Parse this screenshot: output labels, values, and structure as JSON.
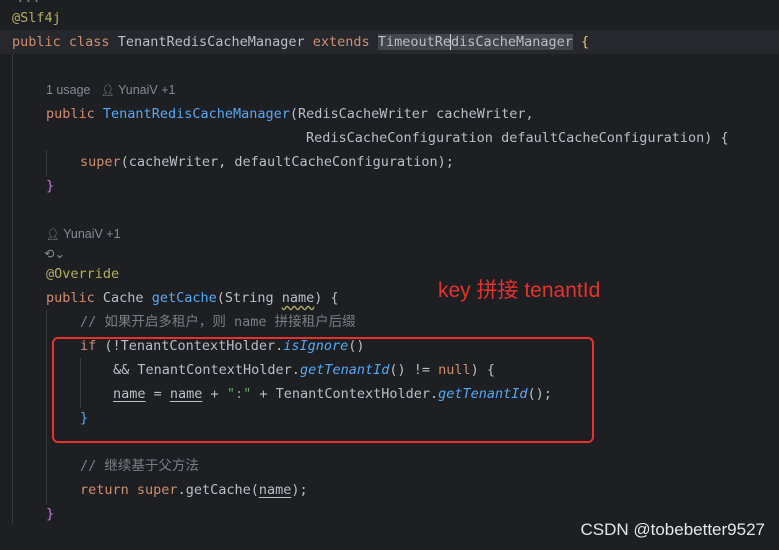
{
  "code": {
    "annotation_slf4j": "@Slf4j",
    "class_decl": {
      "kw_public": "public",
      "kw_class": "class",
      "name": "TenantRedisCacheManager",
      "kw_extends": "extends",
      "parent_a": "TimeoutRe",
      "parent_b": "disCacheManager",
      "brace": "{"
    },
    "ctor_meta": {
      "usage": "1 usage",
      "author": "YunaiV +1"
    },
    "ctor_sig": {
      "kw_public": "public",
      "name": "TenantRedisCacheManager",
      "params1": "(RedisCacheWriter cacheWriter,",
      "params2": "RedisCacheConfiguration defaultCacheConfiguration) {"
    },
    "ctor_body": {
      "kw_super": "super",
      "args": "(cacheWriter, defaultCacheConfiguration);"
    },
    "close_brace": "}",
    "method_meta": {
      "author": "YunaiV +1",
      "icon_label": "⟲⌄"
    },
    "override": "@Override",
    "method_sig": {
      "kw_public": "public",
      "ret": "Cache",
      "name": "getCache",
      "params_open": "(String ",
      "param_name": "name",
      "params_close": ") {"
    },
    "comment1": "// 如果开启多租户，则 name 拼接租户后缀",
    "if_line": {
      "kw_if": "if",
      "open": " (!TenantContextHolder.",
      "call": "isIgnore",
      "paren": "()"
    },
    "and_line": {
      "op": "&& TenantContextHolder.",
      "call": "getTenantId",
      "mid": "() != ",
      "kw_null": "null",
      "close": ") {"
    },
    "assign_line": {
      "lhs": "name",
      "eq": " = ",
      "rhs": "name",
      "plus": " + ",
      "str": "\":\"",
      "plus2": " + TenantContextHolder.",
      "call": "getTenantId",
      "end": "();"
    },
    "inner_close": "}",
    "comment2": "// 继续基于父方法",
    "return_line": {
      "kw_return": "return",
      "kw_super": "super",
      "call": ".getCache(",
      "arg": "name",
      "end": ");"
    },
    "method_close": "}"
  },
  "annotation_note": "key 拼接 tenantId",
  "watermark": "CSDN @tobebetter9527",
  "colors": {
    "background": "#1e1f22",
    "keyword": "#cf8e6d",
    "function": "#56a8f5",
    "annotation": "#b3ae60",
    "static_call": "#c77dbb",
    "comment": "#7a7e85",
    "string": "#6aab73",
    "highlight_box": "#e5322d"
  }
}
